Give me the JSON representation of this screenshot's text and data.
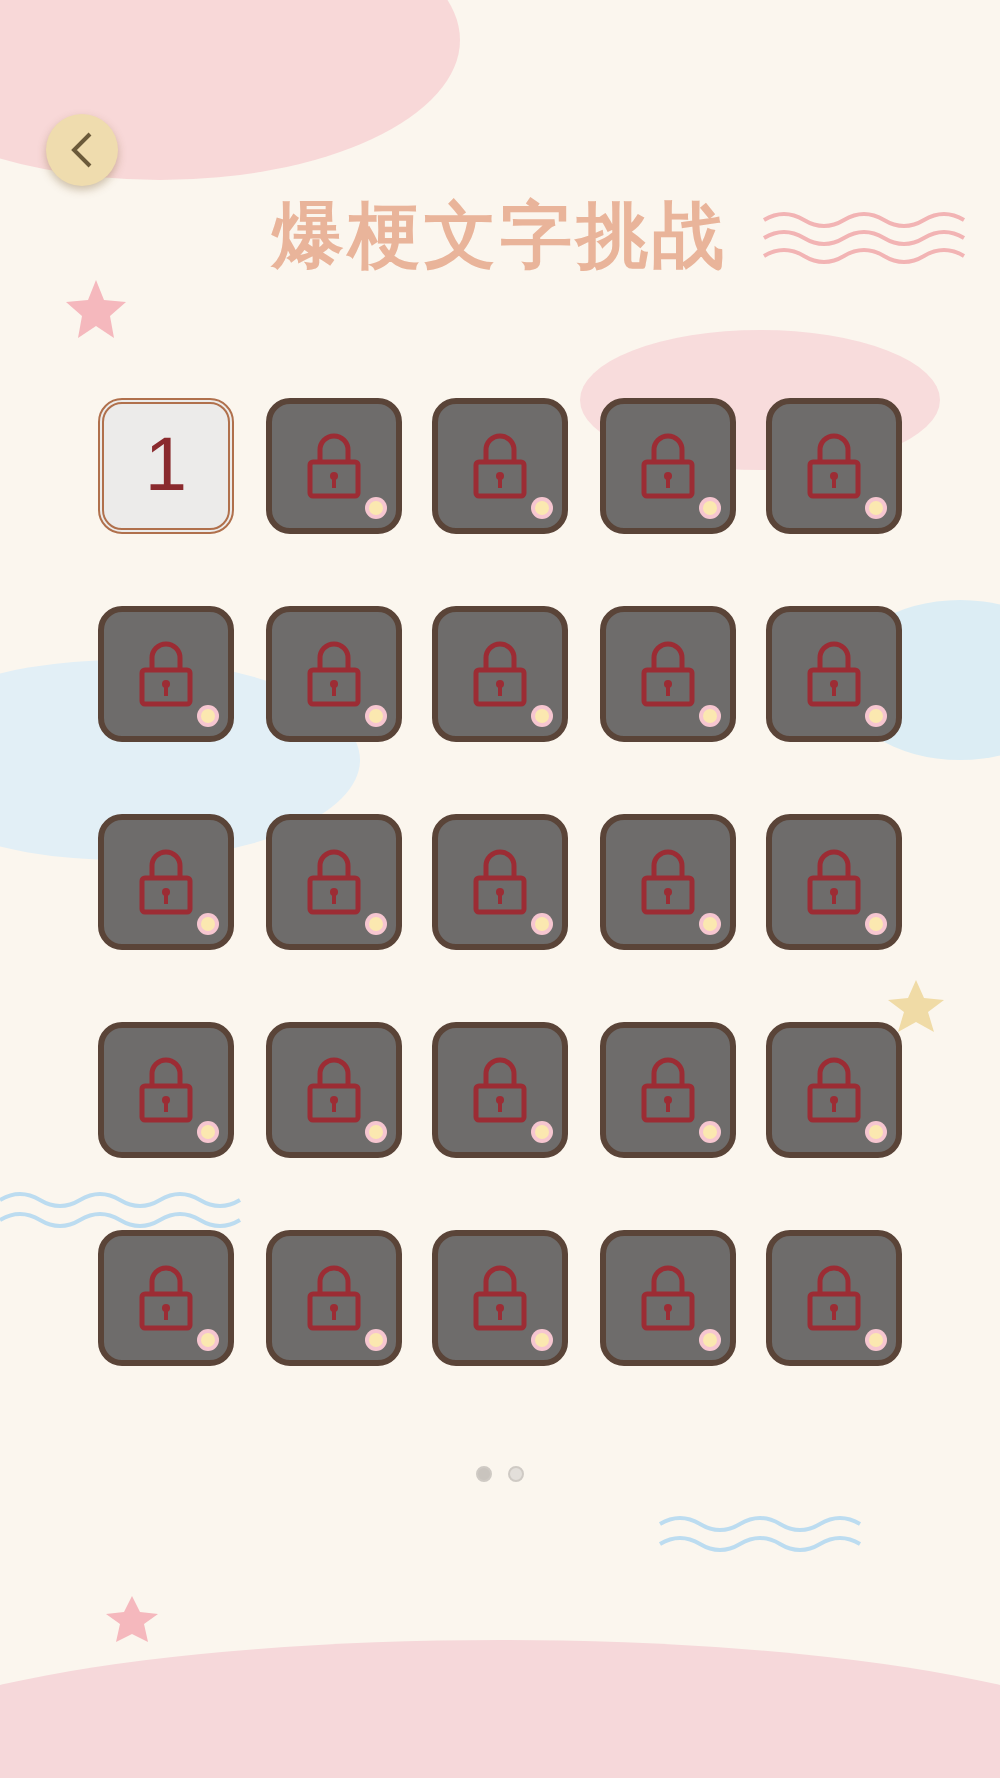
{
  "title": "爆梗文字挑战",
  "levels": [
    {
      "kind": "unlocked",
      "label": "1"
    },
    {
      "kind": "locked"
    },
    {
      "kind": "locked"
    },
    {
      "kind": "locked"
    },
    {
      "kind": "locked"
    },
    {
      "kind": "locked"
    },
    {
      "kind": "locked"
    },
    {
      "kind": "locked"
    },
    {
      "kind": "locked"
    },
    {
      "kind": "locked"
    },
    {
      "kind": "locked"
    },
    {
      "kind": "locked"
    },
    {
      "kind": "locked"
    },
    {
      "kind": "locked"
    },
    {
      "kind": "locked"
    },
    {
      "kind": "locked"
    },
    {
      "kind": "locked"
    },
    {
      "kind": "locked"
    },
    {
      "kind": "locked"
    },
    {
      "kind": "locked"
    },
    {
      "kind": "locked"
    },
    {
      "kind": "locked"
    },
    {
      "kind": "locked"
    },
    {
      "kind": "locked"
    },
    {
      "kind": "locked"
    }
  ],
  "pages": [
    {
      "selected": true
    },
    {
      "selected": false
    }
  ]
}
